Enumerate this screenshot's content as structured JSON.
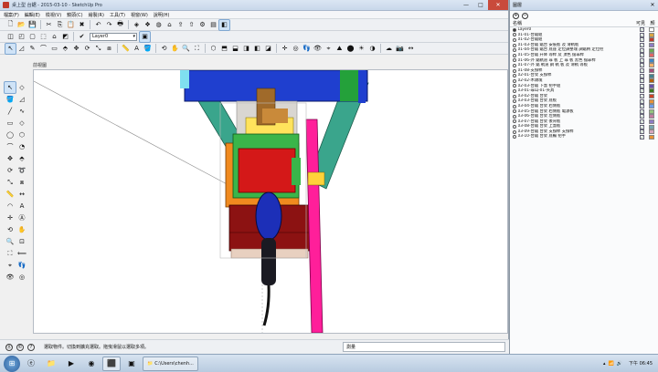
{
  "window": {
    "title": "桌上型 台鋸 - 2015-03-10 - SketchUp Pro",
    "min_label": "—",
    "max_label": "□",
    "close_label": "✕"
  },
  "menu": [
    "檔案(F)",
    "編輯(E)",
    "檢視(V)",
    "鏡頭(C)",
    "繪製(R)",
    "工具(T)",
    "視窗(W)",
    "說明(H)"
  ],
  "toolbar": {
    "layer_select_value": "Layer0"
  },
  "viewport": {
    "scene_tab": "前視圖"
  },
  "status": {
    "message": "選取物件。切換到擴充選取。拖曳滑鼠以選取多項。",
    "measure_label": "測量"
  },
  "layers_panel": {
    "title": "圖層",
    "close_label": "✕",
    "add_label": "+",
    "remove_label": "−",
    "col_name": "名稱",
    "col_visible": "可見",
    "col_color": "顏",
    "layers": [
      {
        "name": "Layer0",
        "active": true,
        "visible": true,
        "color": "#ffffff"
      },
      {
        "name": "01-01-台鋸組",
        "active": false,
        "visible": true,
        "color": "#d9a441"
      },
      {
        "name": "01-02-台鋸組",
        "active": false,
        "visible": true,
        "color": "#c0392b"
      },
      {
        "name": "01-03-台鋸 鋸台 安裝板 及 滑軌板",
        "active": false,
        "visible": true,
        "color": "#8e7cc3"
      },
      {
        "name": "01-04-台鋸 鋸台 底座 定位調整塊 調鋸柄 定位柱",
        "active": false,
        "visible": true,
        "color": "#6aa84f"
      },
      {
        "name": "01-05-台鋸 升降 導桿 及 頂色 擋靠桿",
        "active": false,
        "visible": true,
        "color": "#e06666"
      },
      {
        "name": "01-06-外 鋸軌道 靠 板 上 靠 板 黑色 擋靠桿",
        "active": false,
        "visible": true,
        "color": "#3d85c6"
      },
      {
        "name": "01-07-外 鋸 軌道 鋼 軌 板 及 滑軌 導板",
        "active": false,
        "visible": true,
        "color": "#f6b26b"
      },
      {
        "name": "01-08-支撐桿",
        "active": false,
        "visible": true,
        "color": "#a64d79"
      },
      {
        "name": "02-01-台架 支撐桿",
        "active": false,
        "visible": true,
        "color": "#45818e"
      },
      {
        "name": "02-02-木頭塊",
        "active": false,
        "visible": true,
        "color": "#b45f06"
      },
      {
        "name": "02-03-台鋸 下蓋 把手組",
        "active": false,
        "visible": true,
        "color": "#674ea7"
      },
      {
        "name": "03-01-靠山-01-夾具",
        "active": false,
        "visible": true,
        "color": "#38761d"
      },
      {
        "name": "03-02-台鋸 台架",
        "active": false,
        "visible": true,
        "color": "#cc4125"
      },
      {
        "name": "03-03-台鋸 台架 底板",
        "active": false,
        "visible": true,
        "color": "#e69138"
      },
      {
        "name": "03-04-台鋸 台架 右側板",
        "active": false,
        "visible": true,
        "color": "#6d9eeb"
      },
      {
        "name": "03-05-台鋸 台架 右側板 電源板",
        "active": false,
        "visible": true,
        "color": "#93c47d"
      },
      {
        "name": "03-06-台鋸 台架 左側板",
        "active": false,
        "visible": true,
        "color": "#c27ba0"
      },
      {
        "name": "03-07-台鋸 台架 後背板",
        "active": false,
        "visible": true,
        "color": "#8e7cc3"
      },
      {
        "name": "03-08-台鋸 台架 上蓋板",
        "active": false,
        "visible": true,
        "color": "#76a5af"
      },
      {
        "name": "03-09-台鋸 台架 支撐桿 支撐桿",
        "active": false,
        "visible": true,
        "color": "#d5a6bd"
      },
      {
        "name": "03-10-台鋸 台架 底輪 把手",
        "active": false,
        "visible": true,
        "color": "#e69138"
      }
    ]
  },
  "taskbar": {
    "start_label": "⊞",
    "window_item": "C:\\Users\\chenh...",
    "clock": "下午 06:45"
  }
}
